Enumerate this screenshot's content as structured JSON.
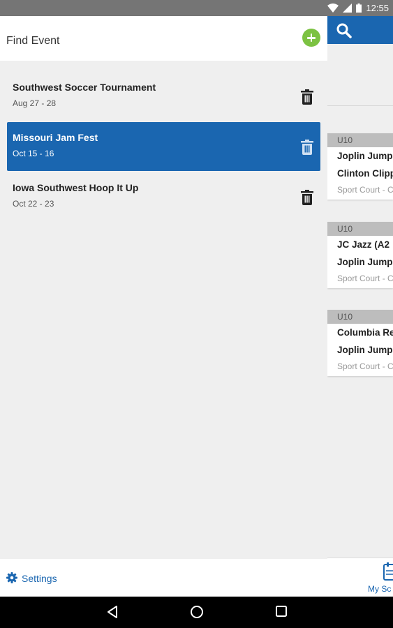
{
  "status_bar": {
    "time": "12:55"
  },
  "drawer": {
    "find_label": "Find Event",
    "events": [
      {
        "name": "Southwest Soccer Tournament",
        "dates": "Aug 27 - 28",
        "selected": false
      },
      {
        "name": "Missouri Jam Fest",
        "dates": "Oct 15 - 16",
        "selected": true
      },
      {
        "name": "Iowa Southwest Hoop It Up",
        "dates": "Oct 22 - 23",
        "selected": false
      }
    ],
    "settings_label": "Settings"
  },
  "main": {
    "games": [
      {
        "division": "U10",
        "team1": "Joplin Jump",
        "team2": "Clinton Clipp",
        "location": "Sport Court - C"
      },
      {
        "division": "U10",
        "team1": "JC Jazz (A2",
        "team2": "Joplin Jump",
        "location": "Sport Court - C"
      },
      {
        "division": "U10",
        "team1": "Columbia Re",
        "team2": "Joplin Jump",
        "location": "Sport Court - C"
      }
    ],
    "bottom_tab_label": "My Sc"
  },
  "colors": {
    "primary": "#1a66b0",
    "add_green": "#7cc242",
    "status_bar": "#757575"
  },
  "icons": {
    "add": "plus-circle-icon",
    "delete": "trash-icon",
    "settings": "gear-icon",
    "search": "search-icon",
    "schedule": "calendar-icon"
  }
}
